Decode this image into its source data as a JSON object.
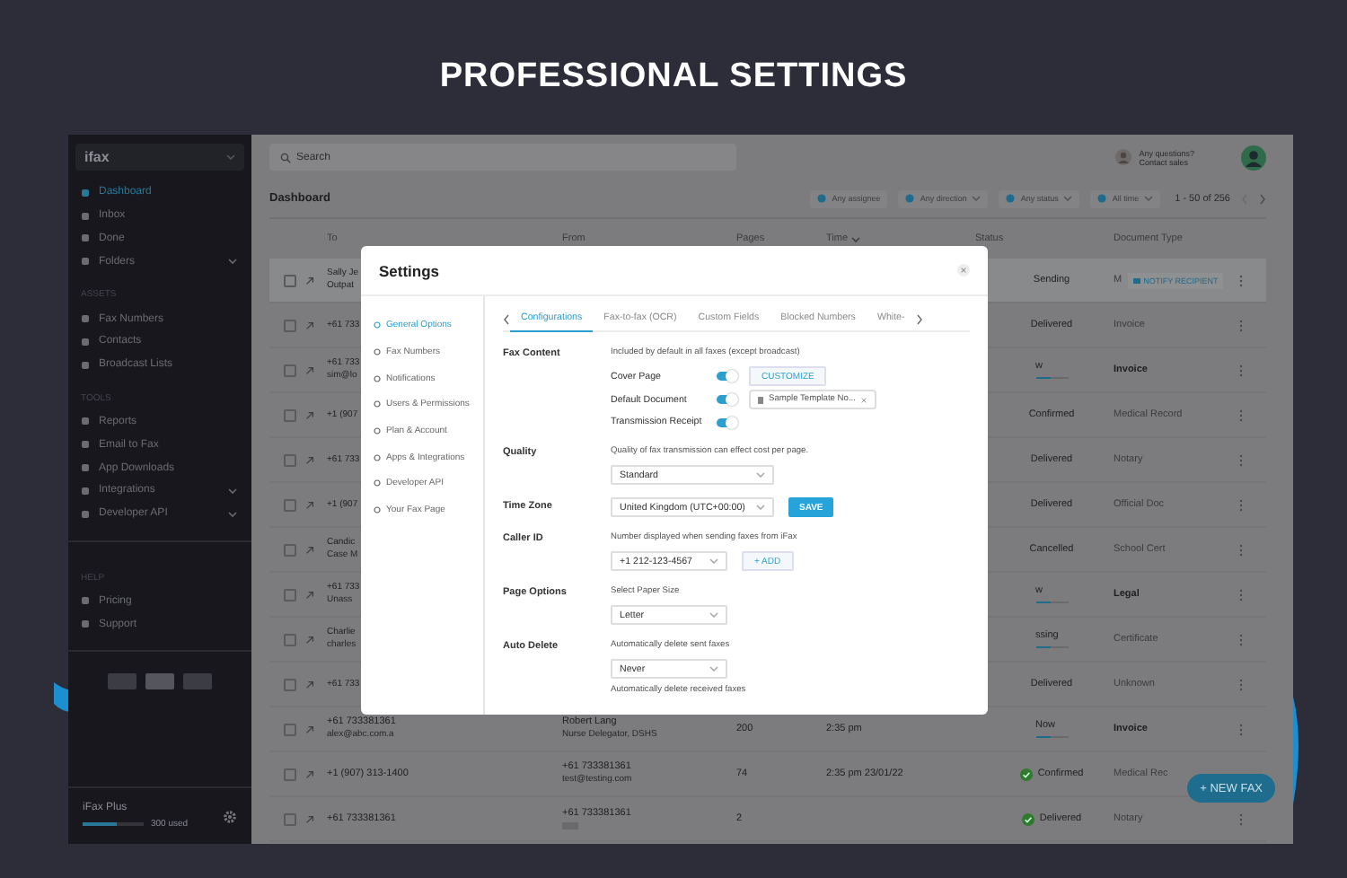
{
  "heading": "PROFESSIONAL SETTINGS",
  "sidebar": {
    "logo": "ifax",
    "groups": [
      {
        "items": [
          {
            "label": "Dashboard",
            "selected": true,
            "expandable": false
          },
          {
            "label": "Inbox",
            "selected": false,
            "expandable": false
          },
          {
            "label": "Done",
            "selected": false,
            "expandable": false
          },
          {
            "label": "Folders",
            "selected": false,
            "expandable": true
          }
        ]
      },
      {
        "title": "ASSETS",
        "items": [
          {
            "label": "Fax Numbers",
            "selected": false,
            "expandable": false
          },
          {
            "label": "Contacts",
            "selected": false,
            "expandable": false
          },
          {
            "label": "Broadcast Lists",
            "selected": false,
            "expandable": false
          }
        ]
      },
      {
        "title": "TOOLS",
        "items": [
          {
            "label": "Reports",
            "selected": false,
            "expandable": false
          },
          {
            "label": "Email to Fax",
            "selected": false,
            "expandable": false
          },
          {
            "label": "App Downloads",
            "selected": false,
            "expandable": false
          },
          {
            "label": "Integrations",
            "selected": false,
            "expandable": true
          },
          {
            "label": "Developer API",
            "selected": false,
            "expandable": true
          }
        ]
      },
      {
        "title": "HELP",
        "items": [
          {
            "label": "Pricing",
            "selected": false,
            "expandable": false
          },
          {
            "label": "Support",
            "selected": false,
            "expandable": false
          }
        ]
      }
    ],
    "plan": {
      "name": "iFax Plus",
      "level": 0.55,
      "usage": "300 used"
    }
  },
  "topbar": {
    "search": {
      "placeholder": "Search"
    },
    "help": {
      "title": "Any questions?",
      "subtitle": "Contact sales"
    }
  },
  "toolbar": {
    "title": "Dashboard",
    "filters": [
      "Any assignee",
      "Any direction",
      "Any status",
      "All time"
    ],
    "pagination": "1 - 50 of 256"
  },
  "table": {
    "columns": [
      "To",
      "From",
      "Pages",
      "Time",
      "Status",
      "Document Type"
    ],
    "rows": [
      {
        "checked": false,
        "selected": true,
        "to": "Sally Je",
        "to_sub": "Outpat",
        "status": "Sending",
        "doc": "M",
        "doc_button": "NOTIFY RECIPIENT",
        "unread": false,
        "actions": true
      },
      {
        "checked": false,
        "selected": false,
        "to": "+61 733",
        "status": "Delivered",
        "doc": "Invoice",
        "unread": false,
        "actions": true
      },
      {
        "checked": false,
        "selected": false,
        "to": "+61 733",
        "to_sub": "sim@lo",
        "status": "w",
        "level": 0.45,
        "doc": "Invoice",
        "unread": true,
        "actions": true
      },
      {
        "checked": false,
        "selected": false,
        "to": "+1 (907",
        "status": "Confirmed",
        "doc": "Medical Record",
        "unread": false,
        "actions": true
      },
      {
        "checked": false,
        "selected": false,
        "to": "+61 733",
        "status": "Delivered",
        "doc": "Notary",
        "unread": false,
        "actions": true
      },
      {
        "checked": false,
        "selected": false,
        "to": "+1 (907",
        "status": "Delivered",
        "doc": "Official Doc",
        "unread": false,
        "actions": true
      },
      {
        "checked": false,
        "selected": false,
        "to": "Candic",
        "to_sub": "Case M",
        "status": "Cancelled",
        "doc": "School Cert",
        "unread": false,
        "actions": true
      },
      {
        "checked": false,
        "selected": false,
        "to": "+61 733",
        "to_sub": "Unass",
        "status": "w",
        "level": 0.45,
        "doc": "Legal",
        "unread": true,
        "actions": true
      },
      {
        "checked": false,
        "selected": false,
        "to": "Charlie",
        "to_sub": "charles",
        "status": "ssing",
        "level": 0.45,
        "doc": "Certificate",
        "unread": false,
        "actions": true
      },
      {
        "checked": false,
        "selected": false,
        "to": "+61 733",
        "status": "Delivered",
        "doc": "Unknown",
        "unread": false,
        "actions": true
      },
      {
        "checked": false,
        "selected": false,
        "to": "+61 733381361",
        "to_sub": "alex@abc.com.a",
        "from": "Robert Lang",
        "from_sub": "Nurse Delegator, DSHS",
        "pages": "200",
        "time": "2:35 pm",
        "status": "Now",
        "level": 0.45,
        "doc": "Invoice",
        "unread": true,
        "actions": true
      },
      {
        "checked": false,
        "selected": false,
        "to": "+1 (907) 313-1400",
        "from": "+61 733381361",
        "from_sub": "test@testing.com",
        "pages": "74",
        "time": "2:35 pm 23/01/22",
        "status": "Confirmed",
        "color": "#2f7a2f",
        "doc": "Medical Rec",
        "unread": false,
        "actions": false
      },
      {
        "checked": false,
        "selected": false,
        "to": "+61 733381361",
        "from": "+61 733381361",
        "from_tag": true,
        "pages": "2",
        "status": "Delivered",
        "color": "#2f7a2f",
        "doc": "Notary",
        "unread": false,
        "actions": true
      }
    ]
  },
  "new_fax_button": "+ NEW FAX",
  "settings": {
    "title": "Settings",
    "nav": [
      {
        "label": "General Options",
        "selected": true
      },
      {
        "label": "Fax Numbers",
        "selected": false
      },
      {
        "label": "Notifications",
        "selected": false
      },
      {
        "label": "Users & Permissions",
        "selected": false
      },
      {
        "label": "Plan & Account",
        "selected": false
      },
      {
        "label": "Apps & Integrations",
        "selected": false
      },
      {
        "label": "Developer API",
        "selected": false
      },
      {
        "label": "Your Fax Page",
        "selected": false
      }
    ],
    "tabs": [
      {
        "label": "Configurations",
        "selected": true
      },
      {
        "label": "Fax-to-fax (OCR)",
        "selected": false
      },
      {
        "label": "Custom Fields",
        "selected": false
      },
      {
        "label": "Blocked Numbers",
        "selected": false
      },
      {
        "label": "White-",
        "selected": false
      }
    ],
    "sections": [
      {
        "label": "Fax Content",
        "lines": [
          [
            {
              "kind": "hint",
              "text": "Included by default in all faxes (except broadcast)"
            }
          ],
          [
            {
              "kind": "toggle",
              "label": "Cover Page",
              "on": true
            },
            {
              "kind": "outlined_button",
              "text": "CUSTOMIZE"
            }
          ],
          [
            {
              "kind": "toggle",
              "label": "Default Document",
              "on": true
            },
            {
              "kind": "chip",
              "text": "Sample Template No..."
            }
          ],
          [
            {
              "kind": "toggle",
              "label": "Transmission Receipt",
              "on": true
            }
          ]
        ]
      },
      {
        "label": "Quality",
        "lines": [
          [
            {
              "kind": "hint",
              "text": "Quality of fax transmission can effect cost per page."
            }
          ],
          [
            {
              "kind": "select",
              "value": "Standard",
              "wide": true
            }
          ]
        ]
      },
      {
        "label": "Time Zone",
        "lines": [
          [
            {
              "kind": "select",
              "value": "United Kingdom (UTC+00:00)",
              "wide": true
            },
            {
              "kind": "filled_button",
              "text": "SAVE"
            }
          ]
        ]
      },
      {
        "label": "Caller ID",
        "lines": [
          [
            {
              "kind": "hint",
              "text": "Number displayed when sending faxes from iFax"
            }
          ],
          [
            {
              "kind": "select",
              "value": "+1 212-123-4567",
              "wide": false
            },
            {
              "kind": "outlined_button",
              "text": "+ ADD"
            }
          ]
        ]
      },
      {
        "label": "Page Options",
        "lines": [
          [
            {
              "kind": "hint",
              "text": "Select Paper Size"
            }
          ],
          [
            {
              "kind": "select",
              "value": "Letter",
              "wide": false
            }
          ]
        ]
      },
      {
        "label": "Auto Delete",
        "lines": [
          [
            {
              "kind": "hint",
              "text": "Automatically delete sent faxes"
            }
          ],
          [
            {
              "kind": "select",
              "value": "Never",
              "wide": false
            }
          ],
          [
            {
              "kind": "hint",
              "text": "Automatically delete received faxes"
            }
          ]
        ]
      }
    ]
  }
}
